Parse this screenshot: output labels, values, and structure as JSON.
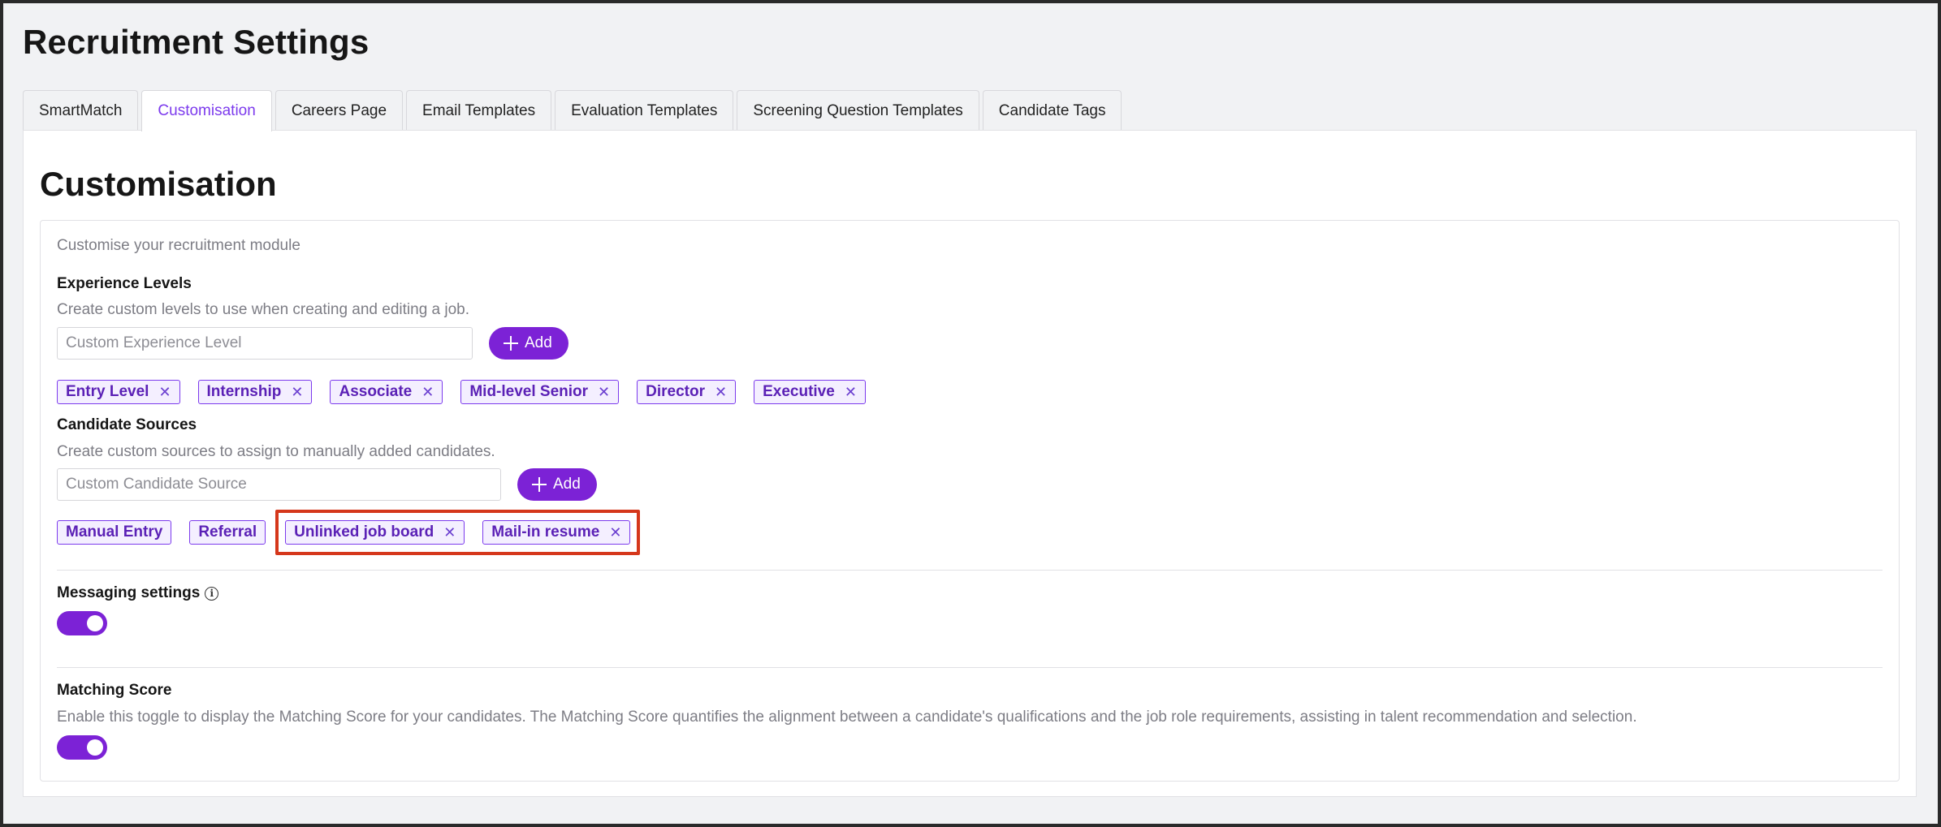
{
  "page": {
    "title": "Recruitment Settings"
  },
  "tabs": [
    {
      "label": "SmartMatch",
      "active": false
    },
    {
      "label": "Customisation",
      "active": true
    },
    {
      "label": "Careers Page",
      "active": false
    },
    {
      "label": "Email Templates",
      "active": false
    },
    {
      "label": "Evaluation Templates",
      "active": false
    },
    {
      "label": "Screening Question Templates",
      "active": false
    },
    {
      "label": "Candidate Tags",
      "active": false
    }
  ],
  "section": {
    "title": "Customisation",
    "description": "Customise your recruitment module"
  },
  "experience_levels": {
    "title": "Experience Levels",
    "description": "Create custom levels to use when creating and editing a job.",
    "input_placeholder": "Custom Experience Level",
    "input_value": "",
    "add_label": "Add",
    "tags": [
      "Entry Level",
      "Internship",
      "Associate",
      "Mid-level Senior",
      "Director",
      "Executive"
    ]
  },
  "candidate_sources": {
    "title": "Candidate Sources",
    "description": "Create custom sources to assign to manually added candidates.",
    "input_placeholder": "Custom Candidate Source",
    "input_value": "",
    "add_label": "Add",
    "fixed_tags": [
      "Manual Entry",
      "Referral"
    ],
    "custom_tags": [
      "Unlinked job board",
      "Mail-in resume"
    ]
  },
  "messaging": {
    "title": "Messaging settings",
    "info_icon": "info-icon",
    "enabled": true
  },
  "matching_score": {
    "title": "Matching Score",
    "description": "Enable this toggle to display the Matching Score for your candidates. The Matching Score quantifies the alignment between a candidate's qualifications and the job role requirements, assisting in talent recommendation and selection.",
    "enabled": true
  },
  "colors": {
    "accent": "#7c22d6",
    "tag_border": "#7c3aed",
    "highlight": "#d5371b"
  }
}
